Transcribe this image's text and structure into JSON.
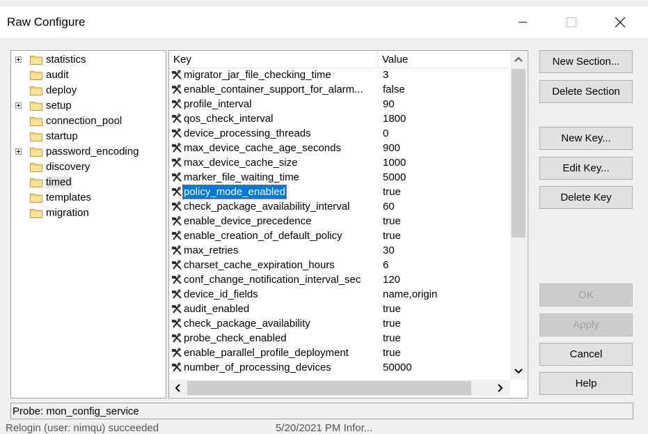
{
  "window": {
    "title": "Raw Configure",
    "controls": {
      "minimize": "minimize",
      "maximize": "maximize",
      "close": "close"
    }
  },
  "tree": {
    "items": [
      {
        "label": "statistics",
        "expandable": true
      },
      {
        "label": "audit",
        "expandable": false
      },
      {
        "label": "deploy",
        "expandable": false
      },
      {
        "label": "setup",
        "expandable": true
      },
      {
        "label": "connection_pool",
        "expandable": false
      },
      {
        "label": "startup",
        "expandable": false
      },
      {
        "label": "password_encoding",
        "expandable": true
      },
      {
        "label": "discovery",
        "expandable": false
      },
      {
        "label": "timed",
        "expandable": false,
        "selected": true
      },
      {
        "label": "templates",
        "expandable": false
      },
      {
        "label": "migration",
        "expandable": false
      }
    ]
  },
  "list": {
    "headers": {
      "key": "Key",
      "value": "Value"
    },
    "rows": [
      {
        "key": "migrator_jar_file_checking_time",
        "value": "3"
      },
      {
        "key": "enable_container_support_for_alarm...",
        "value": "false"
      },
      {
        "key": "profile_interval",
        "value": "90"
      },
      {
        "key": "qos_check_interval",
        "value": "1800"
      },
      {
        "key": "device_processing_threads",
        "value": "0"
      },
      {
        "key": "max_device_cache_age_seconds",
        "value": "900"
      },
      {
        "key": "max_device_cache_size",
        "value": "1000"
      },
      {
        "key": "marker_file_waiting_time",
        "value": "5000"
      },
      {
        "key": "policy_mode_enabled",
        "value": "true",
        "selected": true
      },
      {
        "key": "check_package_availability_interval",
        "value": "60"
      },
      {
        "key": "enable_device_precedence",
        "value": "true"
      },
      {
        "key": "enable_creation_of_default_policy",
        "value": "true"
      },
      {
        "key": "max_retries",
        "value": "30"
      },
      {
        "key": "charset_cache_expiration_hours",
        "value": "6"
      },
      {
        "key": "conf_change_notification_interval_sec",
        "value": "120"
      },
      {
        "key": "device_id_fields",
        "value": "name,origin"
      },
      {
        "key": "audit_enabled",
        "value": "true"
      },
      {
        "key": "check_package_availability",
        "value": "true"
      },
      {
        "key": "probe_check_enabled",
        "value": "true"
      },
      {
        "key": "enable_parallel_profile_deployment",
        "value": "true"
      },
      {
        "key": "number_of_processing_devices",
        "value": "50000"
      }
    ]
  },
  "buttons": {
    "new_section": "New Section...",
    "delete_section": "Delete Section",
    "new_key": "New Key...",
    "edit_key": "Edit Key...",
    "delete_key": "Delete Key",
    "ok": "OK",
    "apply": "Apply",
    "cancel": "Cancel",
    "help": "Help"
  },
  "status": {
    "text": "Probe: mon_config_service"
  },
  "background": {
    "left_text": "Relogin (user: nimqu) succeeded",
    "right_text": "5/20/2021 PM     Infor..."
  },
  "colors": {
    "selection": "#0078d7",
    "window_bg": "#f0f0f0"
  }
}
